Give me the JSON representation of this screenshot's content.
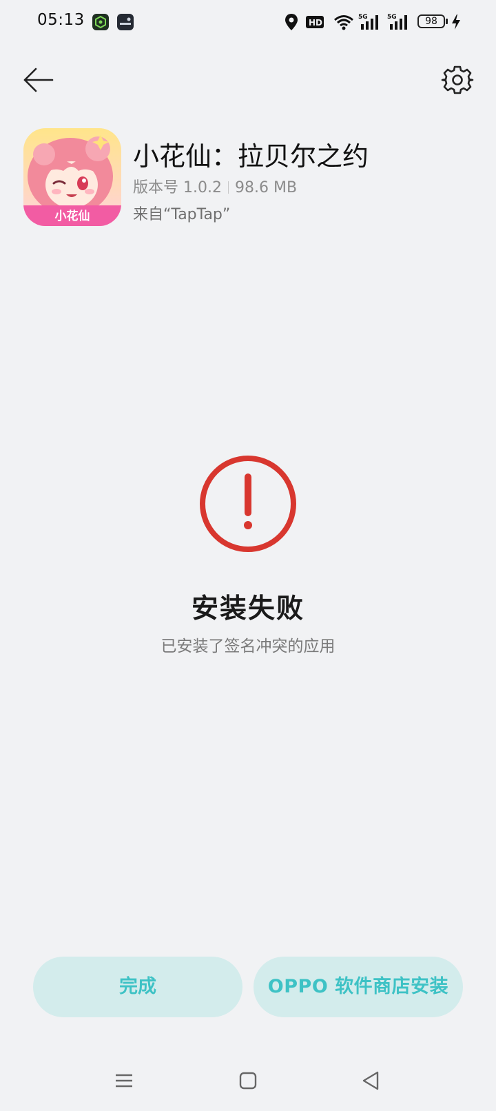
{
  "status_bar": {
    "time": "05:13",
    "battery_level": "98",
    "network_label_1": "5G",
    "network_label_2": "5G",
    "hd_label": "HD"
  },
  "header": {
    "back_icon": "arrow-left-icon",
    "settings_icon": "gear-icon"
  },
  "app": {
    "name": "小花仙：拉贝尔之约",
    "version": "版本号 1.0.2",
    "size": "98.6 MB",
    "source": "来自“TapTap”",
    "icon_logo_text": "小花仙"
  },
  "result": {
    "icon": "alert-circle-icon",
    "icon_color": "#d8372f",
    "title": "安装失败",
    "description": "已安装了签名冲突的应用"
  },
  "actions": {
    "done_label": "完成",
    "store_label": "OPPO 软件商店安装",
    "accent_color": "#3ec2c5",
    "button_bg": "#d3ecec"
  },
  "nav_bar": {
    "items": [
      "menu-icon",
      "home-square-icon",
      "back-triangle-icon"
    ]
  }
}
